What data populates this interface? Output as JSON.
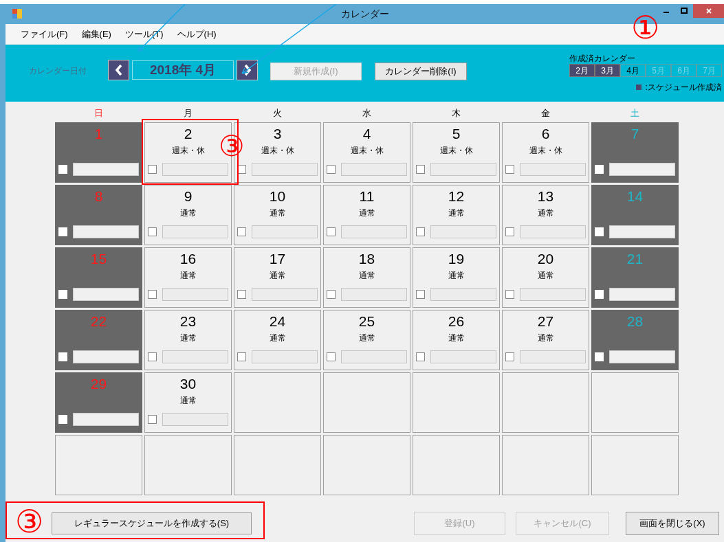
{
  "window": {
    "title": "カレンダー"
  },
  "menu": [
    "ファイル(F)",
    "編集(E)",
    "ツール(T)",
    "ヘルプ(H)"
  ],
  "toolbar": {
    "date_label": "カレンダー日付",
    "date_value": "2018年 4月",
    "new_button": {
      "label": "新規作成(I)",
      "disabled": true
    },
    "delete_button": {
      "label": "カレンダー削除(I)",
      "disabled": false
    }
  },
  "created_calendars": {
    "title": "作成済カレンダー",
    "months": [
      {
        "label": "2月",
        "created": true,
        "selected": false
      },
      {
        "label": "3月",
        "created": true,
        "selected": false
      },
      {
        "label": "4月",
        "created": false,
        "selected": true
      },
      {
        "label": "5月",
        "created": false,
        "selected": false
      },
      {
        "label": "6月",
        "created": false,
        "selected": false
      },
      {
        "label": "7月",
        "created": false,
        "selected": false
      }
    ],
    "legend": ":スケジュール作成済"
  },
  "weekdays": [
    {
      "label": "日",
      "kind": "sunday"
    },
    {
      "label": "月",
      "kind": "weekday"
    },
    {
      "label": "火",
      "kind": "weekday"
    },
    {
      "label": "水",
      "kind": "weekday"
    },
    {
      "label": "木",
      "kind": "weekday"
    },
    {
      "label": "金",
      "kind": "weekday"
    },
    {
      "label": "土",
      "kind": "saturday"
    }
  ],
  "weeks": [
    [
      {
        "kind": "sunday",
        "day": "1",
        "checked": false
      },
      {
        "kind": "weekday",
        "day": "2",
        "label": "週末・休",
        "checked": false
      },
      {
        "kind": "weekday",
        "day": "3",
        "label": "週末・休",
        "checked": false
      },
      {
        "kind": "weekday",
        "day": "4",
        "label": "週末・休",
        "checked": false
      },
      {
        "kind": "weekday",
        "day": "5",
        "label": "週末・休",
        "checked": false
      },
      {
        "kind": "weekday",
        "day": "6",
        "label": "週末・休",
        "checked": false
      },
      {
        "kind": "saturday",
        "day": "7",
        "checked": false
      }
    ],
    [
      {
        "kind": "sunday",
        "day": "8",
        "checked": false
      },
      {
        "kind": "weekday",
        "day": "9",
        "label": "通常",
        "checked": false
      },
      {
        "kind": "weekday",
        "day": "10",
        "label": "通常",
        "checked": false
      },
      {
        "kind": "weekday",
        "day": "11",
        "label": "通常",
        "checked": false
      },
      {
        "kind": "weekday",
        "day": "12",
        "label": "通常",
        "checked": false
      },
      {
        "kind": "weekday",
        "day": "13",
        "label": "通常",
        "checked": false
      },
      {
        "kind": "saturday",
        "day": "14",
        "checked": false
      }
    ],
    [
      {
        "kind": "sunday",
        "day": "15",
        "checked": false
      },
      {
        "kind": "weekday",
        "day": "16",
        "label": "通常",
        "checked": false
      },
      {
        "kind": "weekday",
        "day": "17",
        "label": "通常",
        "checked": false
      },
      {
        "kind": "weekday",
        "day": "18",
        "label": "通常",
        "checked": false
      },
      {
        "kind": "weekday",
        "day": "19",
        "label": "通常",
        "checked": false
      },
      {
        "kind": "weekday",
        "day": "20",
        "label": "通常",
        "checked": false
      },
      {
        "kind": "saturday",
        "day": "21",
        "checked": false
      }
    ],
    [
      {
        "kind": "sunday",
        "day": "22",
        "checked": false
      },
      {
        "kind": "weekday",
        "day": "23",
        "label": "通常",
        "checked": false
      },
      {
        "kind": "weekday",
        "day": "24",
        "label": "通常",
        "checked": false
      },
      {
        "kind": "weekday",
        "day": "25",
        "label": "通常",
        "checked": false
      },
      {
        "kind": "weekday",
        "day": "26",
        "label": "通常",
        "checked": false
      },
      {
        "kind": "weekday",
        "day": "27",
        "label": "通常",
        "checked": false
      },
      {
        "kind": "saturday",
        "day": "28",
        "checked": false
      }
    ],
    [
      {
        "kind": "sunday",
        "day": "29",
        "checked": false
      },
      {
        "kind": "weekday",
        "day": "30",
        "label": "通常",
        "checked": false
      },
      {
        "kind": "empty"
      },
      {
        "kind": "empty"
      },
      {
        "kind": "empty"
      },
      {
        "kind": "empty"
      },
      {
        "kind": "empty"
      }
    ],
    [
      {
        "kind": "empty"
      },
      {
        "kind": "empty"
      },
      {
        "kind": "empty"
      },
      {
        "kind": "empty"
      },
      {
        "kind": "empty"
      },
      {
        "kind": "empty"
      },
      {
        "kind": "empty"
      }
    ]
  ],
  "footer_buttons": [
    {
      "label": "レギュラースケジュールを作成する(S)",
      "disabled": false
    },
    {
      "label": "登録(U)",
      "disabled": true
    },
    {
      "label": "キャンセル(C)",
      "disabled": true
    },
    {
      "label": "画面を閉じる(X)",
      "disabled": false
    }
  ],
  "annotations": [
    {
      "kind": "circled_number",
      "text": "①"
    },
    {
      "kind": "circled_number",
      "text": "③"
    },
    {
      "kind": "circled_number",
      "text": "③"
    }
  ]
}
